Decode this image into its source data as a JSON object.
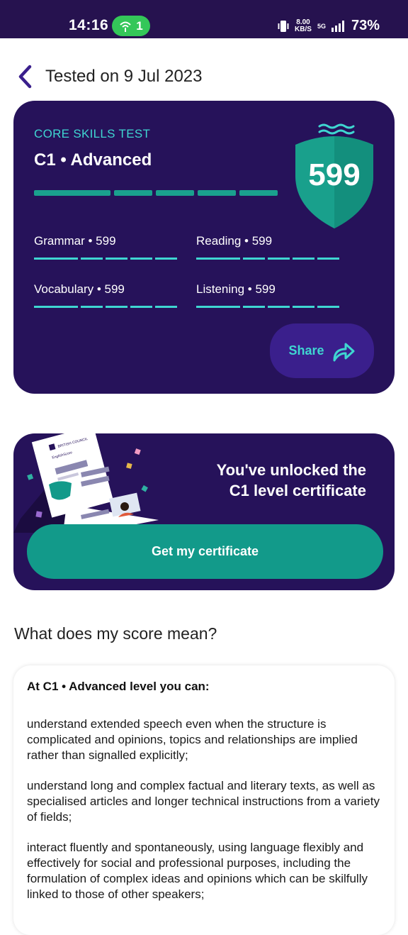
{
  "status_bar": {
    "time": "14:16",
    "hotspot_count": "1",
    "speed_value": "8.00",
    "speed_unit": "KB/S",
    "network": "5G",
    "battery": "73%"
  },
  "header": {
    "title": "Tested on 9 Jul 2023"
  },
  "score_card": {
    "test_label": "CORE SKILLS TEST",
    "level": "C1 • Advanced",
    "overall_score": "599",
    "skills": [
      {
        "label": "Grammar • 599"
      },
      {
        "label": "Reading • 599"
      },
      {
        "label": "Vocabulary • 599"
      },
      {
        "label": "Listening • 599"
      }
    ],
    "share_label": "Share"
  },
  "certificate": {
    "line1": "You've unlocked the",
    "line2": "C1 level certificate",
    "button_label": "Get my certificate",
    "illus_org": "BRITISH COUNCIL",
    "illus_product": "EnglishScore"
  },
  "meaning": {
    "section_title": "What does my score mean?",
    "heading": "At C1 • Advanced level you can:",
    "items": [
      "understand extended speech even when the structure is complicated and opinions, topics and relationships are implied rather than signalled explicitly;",
      "understand long and complex factual and literary texts, as well as specialised articles and longer technical instructions from a variety of fields;",
      "interact fluently and spontaneously, using language flexibly and effectively for social and professional purposes, including the formulation of complex ideas and opinions which can be skilfully linked to those of other speakers;"
    ]
  },
  "colors": {
    "card_bg": "#26125a",
    "accent_teal": "#3fd6d1",
    "button_teal": "#129a8a",
    "status_bar_bg": "#26124f"
  }
}
